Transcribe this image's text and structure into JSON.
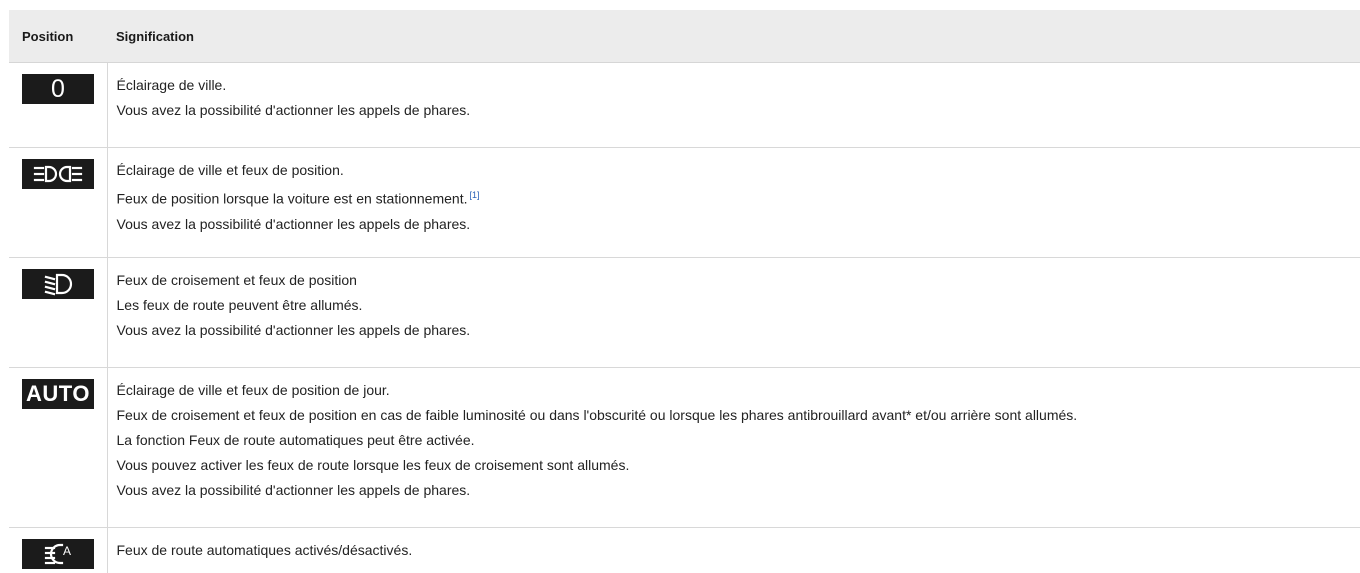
{
  "header": {
    "col_position": "Position",
    "col_signification": "Signification"
  },
  "rows": [
    {
      "icon": "zero-position-icon",
      "symbol": "0",
      "lines": [
        "Éclairage de ville.",
        "Vous avez la possibilité d'actionner les appels de phares."
      ]
    },
    {
      "icon": "parking-lights-icon",
      "lines": [
        "Éclairage de ville et feux de position.",
        "Feux de position lorsque la voiture est en stationnement.",
        "Vous avez la possibilité d'actionner les appels de phares."
      ],
      "footnote": "[1]"
    },
    {
      "icon": "dipped-beam-icon",
      "lines": [
        "Feux de croisement et feux de position",
        "Les feux de route peuvent être allumés.",
        "Vous avez la possibilité d'actionner les appels de phares."
      ]
    },
    {
      "icon": "auto-lights-icon",
      "symbol": "AUTO",
      "lines": [
        "Éclairage de ville et feux de position de jour.",
        "Feux de croisement et feux de position en cas de faible luminosité ou dans l'obscurité ou lorsque les phares antibrouillard avant* et/ou arrière sont allumés.",
        "La fonction Feux de route automatiques peut être activée.",
        "Vous pouvez activer les feux de route lorsque les feux de croisement sont allumés.",
        "Vous avez la possibilité d'actionner les appels de phares."
      ]
    },
    {
      "icon": "auto-high-beam-icon",
      "symbol": "A",
      "lines": [
        "Feux de route automatiques activés/désactivés."
      ]
    }
  ],
  "colors": {
    "header_bg": "#ececec",
    "badge_bg": "#1b1b1b",
    "badge_fg": "#ffffff",
    "footnote": "#2a62b8",
    "divider": "#d8d8d8"
  }
}
